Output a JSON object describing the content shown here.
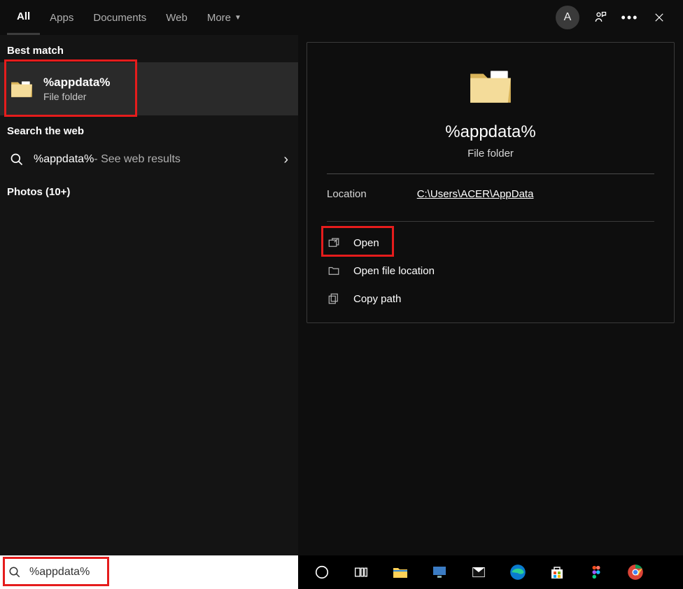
{
  "header": {
    "tabs": [
      "All",
      "Apps",
      "Documents",
      "Web",
      "More"
    ],
    "avatar_initial": "A"
  },
  "left": {
    "best_match": "Best match",
    "result": {
      "title": "%appdata%",
      "sub": "File folder"
    },
    "search_web_header": "Search the web",
    "web": {
      "query": "%appdata%",
      "suffix": " - See web results"
    },
    "photos": "Photos (10+)"
  },
  "preview": {
    "title": "%appdata%",
    "sub": "File folder",
    "location_label": "Location",
    "location_path": "C:\\Users\\ACER\\AppData",
    "actions": {
      "open": "Open",
      "open_loc": "Open file location",
      "copy": "Copy path"
    }
  },
  "searchbox": {
    "value": "%appdata%"
  }
}
